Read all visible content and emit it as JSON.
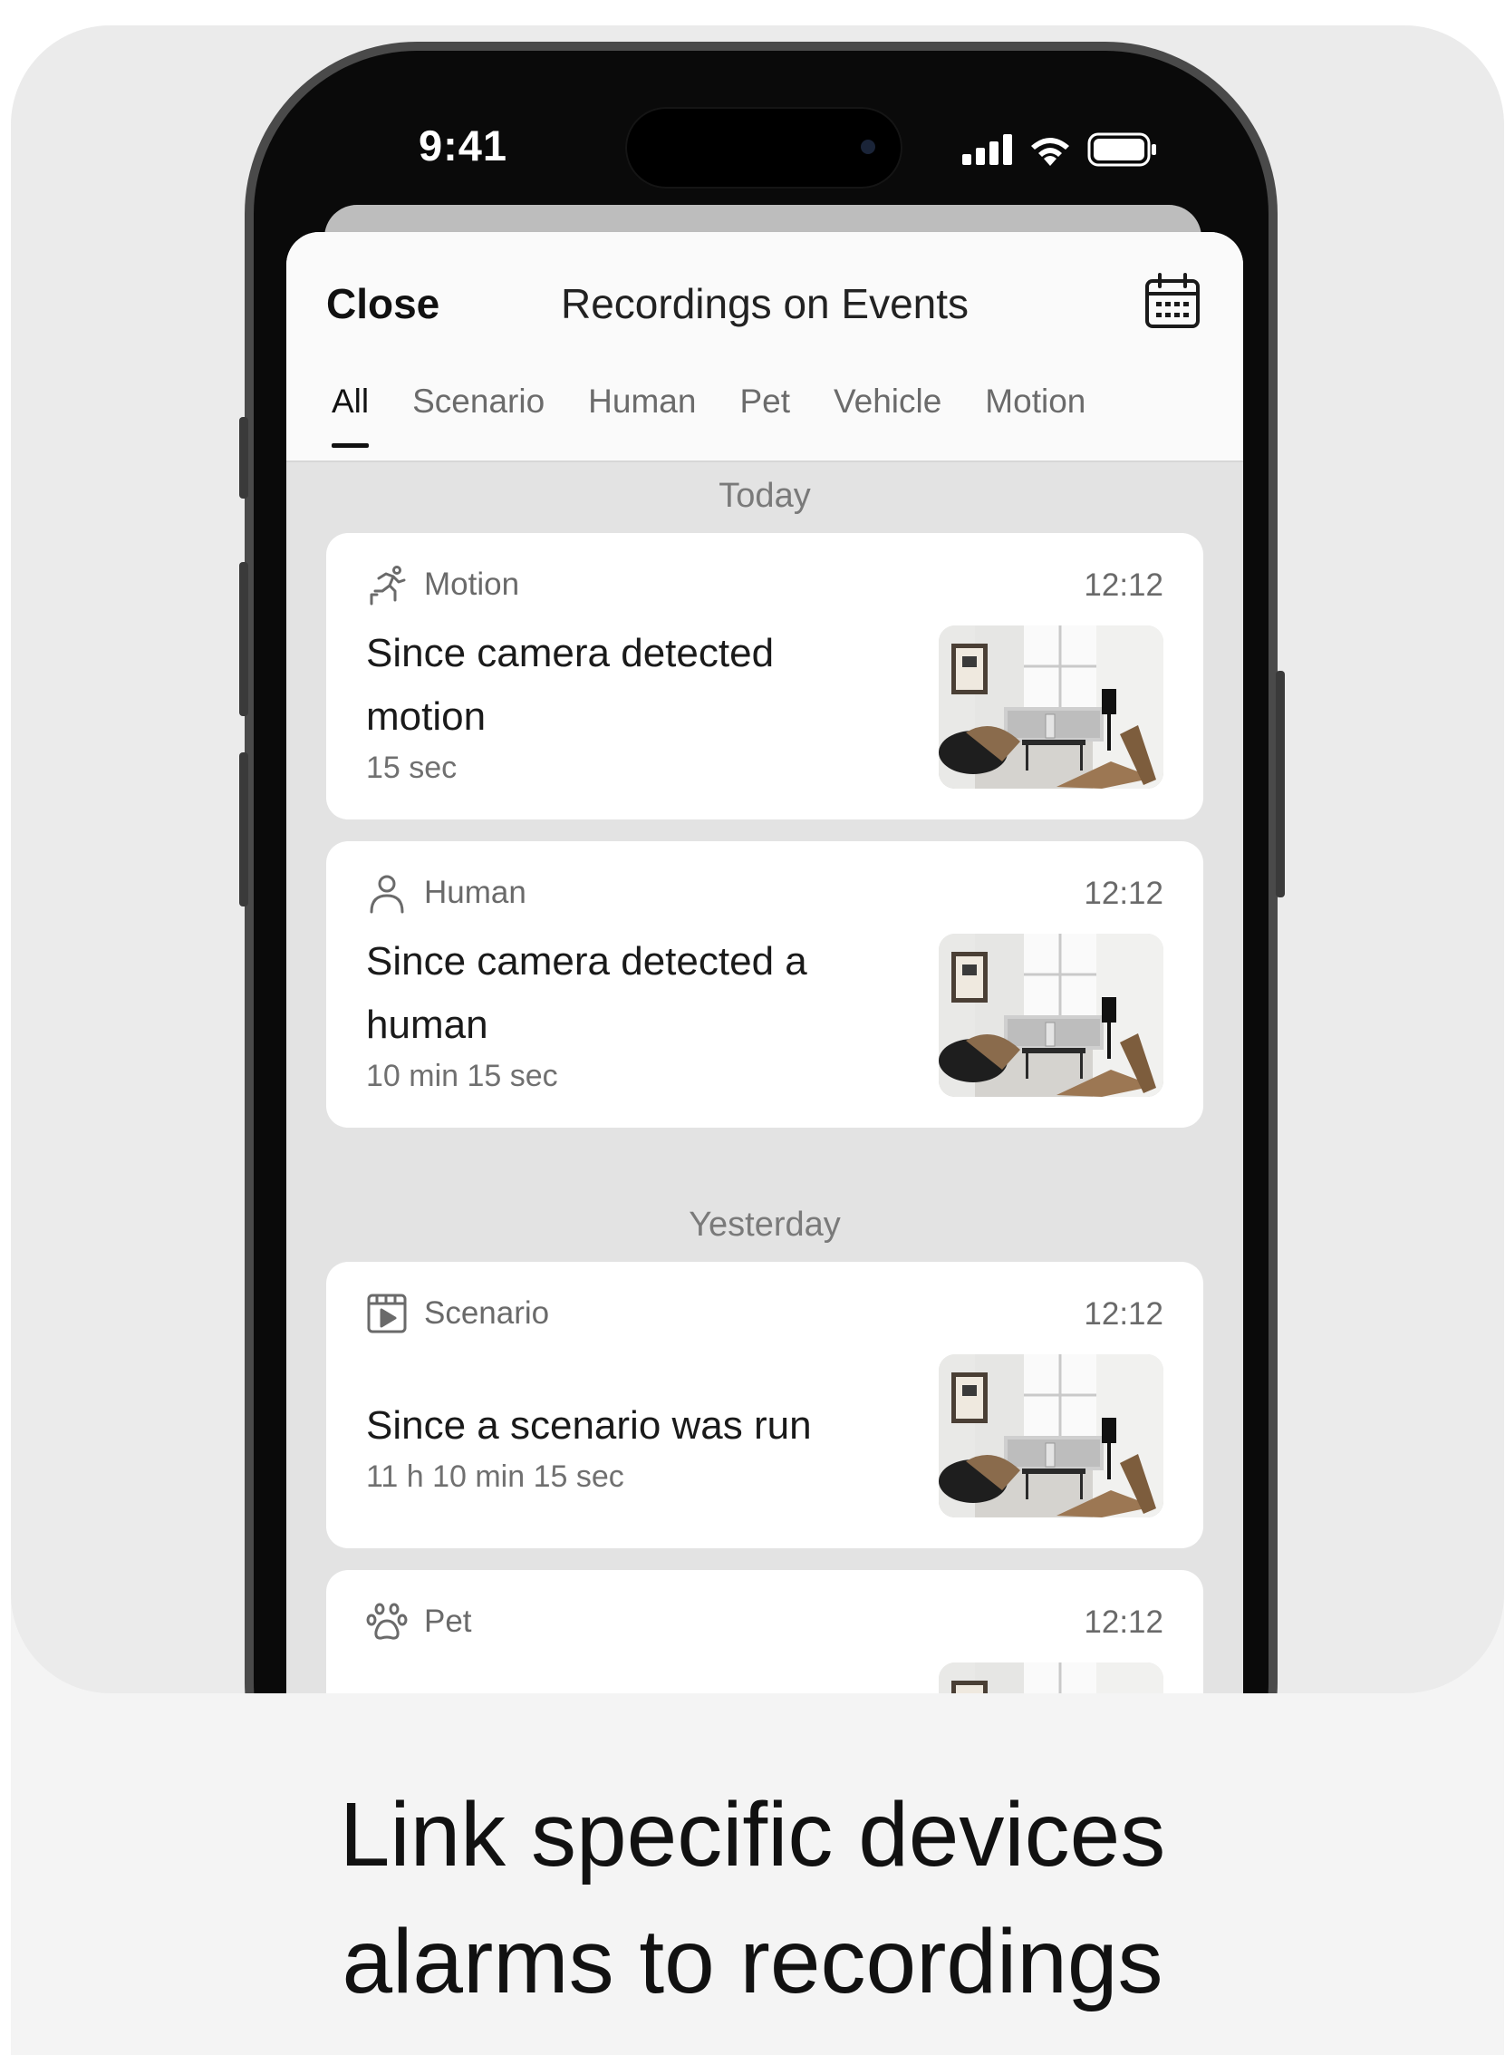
{
  "status_bar": {
    "time": "9:41",
    "icons": [
      "signal-icon",
      "wifi-icon",
      "battery-icon"
    ]
  },
  "header": {
    "close_label": "Close",
    "title": "Recordings on Events",
    "calendar_icon": "calendar-icon"
  },
  "tabs": [
    {
      "label": "All",
      "active": true
    },
    {
      "label": "Scenario",
      "active": false
    },
    {
      "label": "Human",
      "active": false
    },
    {
      "label": "Pet",
      "active": false
    },
    {
      "label": "Vehicle",
      "active": false
    },
    {
      "label": "Motion",
      "active": false
    }
  ],
  "sections": [
    {
      "day": "Today",
      "events": [
        {
          "category": "Motion",
          "icon": "running-person-icon",
          "time": "12:12",
          "title": "Since camera detected motion",
          "duration": "15 sec"
        },
        {
          "category": "Human",
          "icon": "person-icon",
          "time": "12:12",
          "title": "Since camera detected a human",
          "duration": "10 min 15 sec"
        }
      ]
    },
    {
      "day": "Yesterday",
      "events": [
        {
          "category": "Scenario",
          "icon": "scenario-play-icon",
          "time": "12:12",
          "title": "Since a scenario was run",
          "duration": "11 h 10 min 15 sec"
        },
        {
          "category": "Pet",
          "icon": "paw-icon",
          "time": "12:12"
        }
      ]
    }
  ],
  "caption": {
    "line1": "Link specific devices",
    "line2": "alarms to recordings"
  },
  "colors": {
    "backdrop": "#ebebeb",
    "caption_bg": "#f4f4f4",
    "sheet_bg": "#e3e3e3",
    "card_bg": "#ffffff",
    "text_primary": "#111111",
    "text_secondary": "#6a6a6a"
  }
}
